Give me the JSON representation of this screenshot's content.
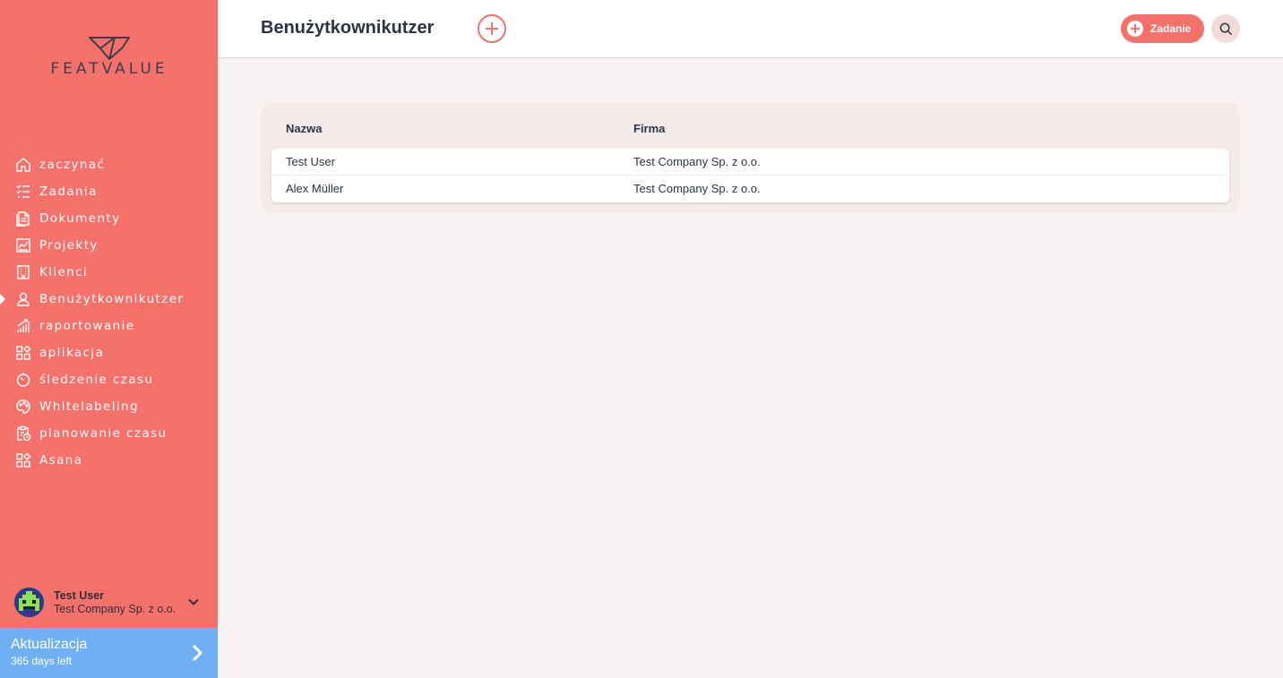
{
  "brand": {
    "logo_text": "FEATVALUE"
  },
  "sidebar": {
    "items": [
      {
        "label": "zaczynać",
        "icon": "home-icon"
      },
      {
        "label": "Zadania",
        "icon": "task-list-icon"
      },
      {
        "label": "Dokumenty",
        "icon": "document-icon"
      },
      {
        "label": "Projekty",
        "icon": "chart-board-icon"
      },
      {
        "label": "Klienci",
        "icon": "building-icon"
      },
      {
        "label": "Benużytkownikutzer",
        "icon": "user-icon",
        "active": true
      },
      {
        "label": "raportowanie",
        "icon": "bar-chart-icon"
      },
      {
        "label": "aplikacja",
        "icon": "apps-grid-icon"
      },
      {
        "label": "śledzenie czasu",
        "icon": "timer-icon"
      },
      {
        "label": "Whitelabeling",
        "icon": "palette-icon"
      },
      {
        "label": "planowanie czasu",
        "icon": "clipboard-clock-icon"
      },
      {
        "label": "Asana",
        "icon": "apps-grid-icon"
      }
    ]
  },
  "user": {
    "name": "Test User",
    "company": "Test Company Sp. z o.o."
  },
  "upgrade": {
    "title": "Aktualizacja",
    "subtitle": "365 days left"
  },
  "header": {
    "title": "Benużytkownikutzer",
    "task_button": "Zadanie"
  },
  "table": {
    "columns": [
      "Nazwa",
      "Firma"
    ],
    "rows": [
      [
        "Test User",
        "Test Company Sp. z o.o."
      ],
      [
        "Alex Müller",
        "Test Company Sp. z o.o."
      ]
    ]
  },
  "colors": {
    "accent": "#f4726b",
    "upgrade": "#6fb0f5",
    "text": "#2b3445"
  }
}
